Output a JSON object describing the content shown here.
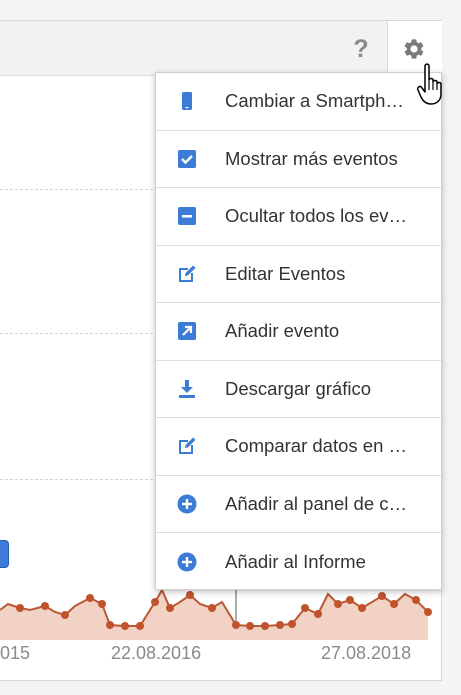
{
  "toolbar": {
    "help_icon": "question-mark-icon",
    "settings_icon": "gear-icon"
  },
  "menu": {
    "items": [
      {
        "label": "Cambiar a Smartph…",
        "icon": "smartphone-icon"
      },
      {
        "label": "Mostrar más eventos",
        "icon": "checkbox-checked-icon"
      },
      {
        "label": "Ocultar todos los ev…",
        "icon": "minus-box-icon"
      },
      {
        "label": "Editar Eventos",
        "icon": "edit-icon"
      },
      {
        "label": "Añadir evento",
        "icon": "arrow-box-icon"
      },
      {
        "label": "Descargar gráfico",
        "icon": "download-icon"
      },
      {
        "label": "Comparar datos en …",
        "icon": "edit-icon"
      },
      {
        "label": "Añadir al panel de c…",
        "icon": "plus-circle-icon"
      },
      {
        "label": "Añadir al Informe",
        "icon": "plus-circle-icon"
      }
    ]
  },
  "chart": {
    "x_labels": [
      "015",
      "22.08.2016",
      "27.08.2018"
    ]
  },
  "colors": {
    "accent": "#3c7bd6",
    "series_line": "#b85a35",
    "series_fill": "#f1d2c4",
    "menu_text": "#333333"
  }
}
